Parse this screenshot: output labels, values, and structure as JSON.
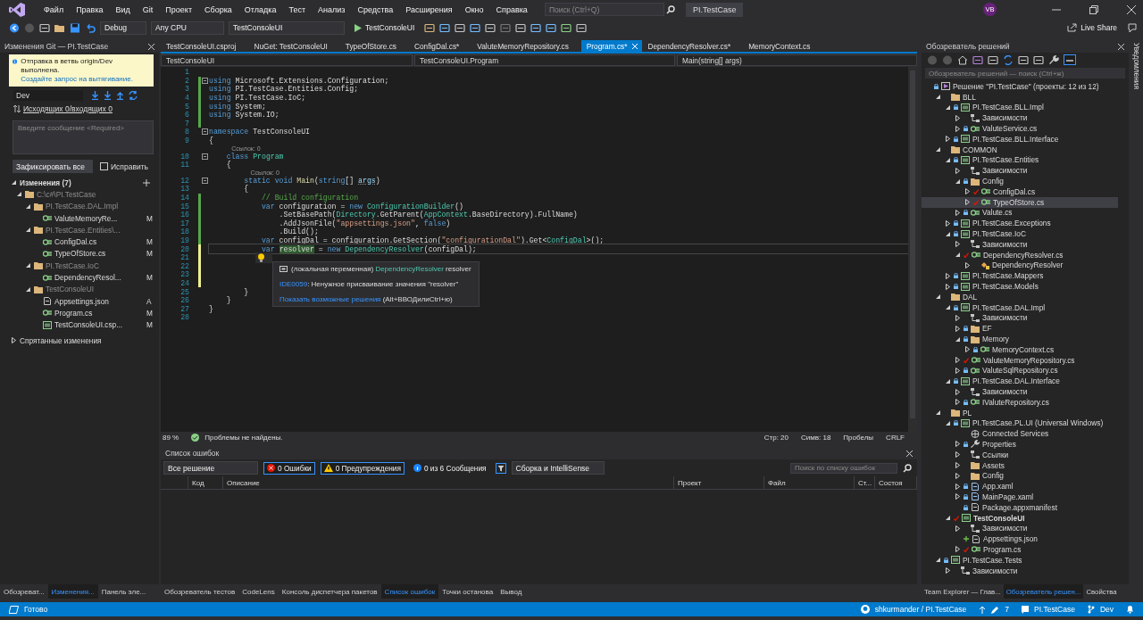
{
  "window": {
    "title": "PI.TestCase",
    "avatar": "VB",
    "live_share": "Live Share"
  },
  "menu": [
    "Файл",
    "Правка",
    "Вид",
    "Git",
    "Проект",
    "Сборка",
    "Отладка",
    "Тест",
    "Анализ",
    "Средства",
    "Расширения",
    "Окно",
    "Справка"
  ],
  "search": {
    "placeholder": "Поиск (Ctrl+Q)"
  },
  "toolbar": {
    "configuration": "Debug",
    "platform": "Any CPU",
    "startup_project": "TestConsoleUI",
    "run": "TestConsoleUI"
  },
  "git_panel": {
    "title": "Изменения Git — PI.TestCase",
    "notice": [
      {
        "kind": "plain",
        "text": "Отправка в ветвь origin/Dev выполнена. "
      },
      {
        "kind": "link",
        "text": "Создайте запрос на вытягивание."
      }
    ],
    "branch": "Dev",
    "sync": "Исходящих 0/входящих 0",
    "message": {
      "placeholder": "Введите сообщение <Required>"
    },
    "commit_button": "Зафиксировать все",
    "amend": {
      "label": "Исправить",
      "checked": false
    },
    "changes": {
      "label": "Изменения (7)",
      "expanded": true,
      "children": [
        {
          "label": "C:\\c#\\PI.TestCase",
          "kind": "folder",
          "expanded": true,
          "children": [
            {
              "label": "PI.TestCase.DAL.Impl",
              "kind": "folder",
              "expanded": true,
              "children": [
                {
                  "label": "ValuteMemoryRe...",
                  "kind": "cs",
                  "change": "M"
                }
              ]
            },
            {
              "label": "PI.TestCase.Entities\\...",
              "kind": "folder",
              "expanded": true,
              "children": [
                {
                  "label": "ConfigDal.cs",
                  "kind": "cs",
                  "change": "M"
                },
                {
                  "label": "TypeOfStore.cs",
                  "kind": "cs",
                  "change": "M"
                }
              ]
            },
            {
              "label": "PI.TestCase.IoC",
              "kind": "folder",
              "expanded": true,
              "children": [
                {
                  "label": "DependencyResol...",
                  "kind": "cs",
                  "change": "M"
                }
              ]
            },
            {
              "label": "TestConsoleUI",
              "kind": "folder",
              "expanded": true,
              "children": [
                {
                  "label": "Appsettings.json",
                  "kind": "json",
                  "change": "A"
                },
                {
                  "label": "Program.cs",
                  "kind": "cs",
                  "change": "M"
                },
                {
                  "label": "TestConsoleUI.csp...",
                  "kind": "csproj",
                  "change": "M"
                }
              ]
            }
          ]
        }
      ]
    },
    "stashes": {
      "label": "Спрятанные изменения",
      "expanded": false
    }
  },
  "doc_tabs": [
    {
      "label": "TestConsoleUI.csproj",
      "selected": false
    },
    {
      "label": "NuGet: TestConsoleUI",
      "selected": false
    },
    {
      "label": "TypeOfStore.cs",
      "selected": false
    },
    {
      "label": "ConfigDal.cs*",
      "selected": false
    },
    {
      "label": "ValuteMemoryRepository.cs",
      "selected": false
    },
    {
      "label": "Program.cs*",
      "selected": true
    },
    {
      "label": "DependencyResolver.cs*",
      "selected": false
    },
    {
      "label": "MemoryContext.cs",
      "selected": false
    }
  ],
  "nav_bar": {
    "project": "TestConsoleUI",
    "type": "TestConsoleUI.Program",
    "member": "Main(string[] args)"
  },
  "code": [
    {
      "num": "1"
    },
    {
      "num": "2",
      "saved": true,
      "fold": true,
      "tokens": [
        {
          "kind": "kw",
          "text": "using"
        },
        {
          "kind": "plain",
          "text": " Microsoft.Extensions.Configuration;"
        }
      ]
    },
    {
      "num": "3",
      "saved": true,
      "tokens": [
        {
          "kind": "kw",
          "text": "using"
        },
        {
          "kind": "plain",
          "text": " PI.TestCase.Entities.Config;"
        }
      ]
    },
    {
      "num": "4",
      "saved": true,
      "tokens": [
        {
          "kind": "kw",
          "text": "using"
        },
        {
          "kind": "plain",
          "text": " PI.TestCase.IoC;"
        }
      ]
    },
    {
      "num": "5",
      "saved": true,
      "tokens": [
        {
          "kind": "kw",
          "text": "using"
        },
        {
          "kind": "plain",
          "text": " System;"
        }
      ]
    },
    {
      "num": "6",
      "saved": true,
      "tokens": [
        {
          "kind": "kw",
          "text": "using"
        },
        {
          "kind": "plain",
          "text": " System.IO;"
        }
      ]
    },
    {
      "num": "7",
      "saved": true
    },
    {
      "num": "8",
      "fold": true,
      "tokens": [
        {
          "kind": "kw",
          "text": "namespace"
        },
        {
          "kind": "plain",
          "text": " TestConsoleUI"
        }
      ]
    },
    {
      "num": "9",
      "tokens": [
        {
          "kind": "plain",
          "text": "{"
        }
      ]
    },
    {
      "num": "10",
      "fold": true,
      "lens": "Ссылок: 0",
      "tokens": [
        {
          "kind": "kw",
          "text": "    class "
        },
        {
          "kind": "type",
          "text": "Program"
        }
      ]
    },
    {
      "num": "11",
      "tokens": [
        {
          "kind": "plain",
          "text": "    {"
        }
      ]
    },
    {
      "num": "12",
      "fold": true,
      "lens": "Ссылок: 0",
      "tokens": [
        {
          "kind": "kw",
          "text": "        static void "
        },
        {
          "kind": "method",
          "text": "Main"
        },
        {
          "kind": "plain",
          "text": "("
        },
        {
          "kind": "kw",
          "text": "string"
        },
        {
          "kind": "plain",
          "text": "[] "
        },
        {
          "kind": "param",
          "text": "args"
        },
        {
          "kind": "plain",
          "text": ")"
        }
      ]
    },
    {
      "num": "13",
      "tokens": [
        {
          "kind": "plain",
          "text": "        {"
        }
      ]
    },
    {
      "num": "14",
      "saved": true,
      "tokens": [
        {
          "kind": "comment",
          "text": "            // Build configuration"
        }
      ]
    },
    {
      "num": "15",
      "saved": true,
      "tokens": [
        {
          "kind": "kw",
          "text": "            var"
        },
        {
          "kind": "plain",
          "text": " configuration = "
        },
        {
          "kind": "kw",
          "text": "new "
        },
        {
          "kind": "type",
          "text": "ConfigurationBuilder"
        },
        {
          "kind": "plain",
          "text": "()"
        }
      ]
    },
    {
      "num": "16",
      "saved": true,
      "tokens": [
        {
          "kind": "plain",
          "text": "                .SetBasePath("
        },
        {
          "kind": "type",
          "text": "Directory"
        },
        {
          "kind": "plain",
          "text": ".GetParent("
        },
        {
          "kind": "type",
          "text": "AppContext"
        },
        {
          "kind": "plain",
          "text": ".BaseDirectory).FullName)"
        }
      ]
    },
    {
      "num": "17",
      "saved": true,
      "tokens": [
        {
          "kind": "plain",
          "text": "                .AddJsonFile("
        },
        {
          "kind": "string",
          "text": "\"appsettings.json\""
        },
        {
          "kind": "plain",
          "text": ", "
        },
        {
          "kind": "kw",
          "text": "false"
        },
        {
          "kind": "plain",
          "text": ")"
        }
      ]
    },
    {
      "num": "18",
      "saved": true,
      "tokens": [
        {
          "kind": "plain",
          "text": "                .Build();"
        }
      ]
    },
    {
      "num": "19",
      "saved": true,
      "tokens": [
        {
          "kind": "kw",
          "text": "            var"
        },
        {
          "kind": "plain",
          "text": " configDal = configuration.GetSection("
        },
        {
          "kind": "string",
          "text": "\"configurationDal\""
        },
        {
          "kind": "plain",
          "text": ").Get<"
        },
        {
          "kind": "type",
          "text": "ConfigDal"
        },
        {
          "kind": "plain",
          "text": ">();"
        }
      ]
    },
    {
      "num": "20",
      "saved": false,
      "current": true,
      "tokens": [
        {
          "kind": "kw",
          "text": "            var "
        },
        {
          "kind": "highlight",
          "text": "resolver"
        },
        {
          "kind": "plain",
          "text": " = "
        },
        {
          "kind": "kw",
          "text": "new "
        },
        {
          "kind": "type",
          "text": "DependencyResolver"
        },
        {
          "kind": "plain",
          "text": "(configDal);"
        }
      ]
    },
    {
      "num": "21",
      "saved": false,
      "lightbulb": true
    },
    {
      "num": "22",
      "saved": false
    },
    {
      "num": "23",
      "saved": false
    },
    {
      "num": "24",
      "saved": false
    },
    {
      "num": "25",
      "tokens": [
        {
          "kind": "plain",
          "text": "        }"
        }
      ]
    },
    {
      "num": "26",
      "tokens": [
        {
          "kind": "plain",
          "text": "    }"
        }
      ]
    },
    {
      "num": "27",
      "tokens": [
        {
          "kind": "plain",
          "text": "}"
        }
      ]
    },
    {
      "num": "28"
    }
  ],
  "quick_info": [
    [
      {
        "kind": "plain",
        "text": "(локальная переменная) "
      },
      {
        "kind": "type",
        "text": "DependencyResolver"
      },
      {
        "kind": "plain",
        "text": " resolver"
      }
    ],
    [
      {
        "kind": "link",
        "text": "IDE0059"
      },
      {
        "kind": "plain",
        "text": ": Ненужное присваивание значения \"resolver\""
      }
    ],
    [
      {
        "kind": "link",
        "text": "Показать возможные решения"
      },
      {
        "kind": "plain",
        "text": " (Alt+ВВОДилиCtrl+ю)"
      }
    ]
  ],
  "editor_status": {
    "zoom": "89 %",
    "issues": "Проблемы не найдены.",
    "line": "Стр: 20",
    "column": "Симв: 18",
    "whitespace": "Пробелы",
    "line_endings": "CRLF"
  },
  "error_list": {
    "title": "Список ошибок",
    "scope": "Все решение",
    "errors": {
      "label": "0 Ошибки",
      "selected": true
    },
    "warnings": {
      "label": "0 Предупреждения",
      "selected": true
    },
    "messages": {
      "label": "0 из 6 Сообщения",
      "selected": false
    },
    "source": "Сборка и IntelliSense",
    "search": {
      "placeholder": "Поиск по списку ошибок"
    },
    "columns": [
      "Код",
      "Описание",
      "Проект",
      "Файл",
      "Ст...",
      "Состоя"
    ]
  },
  "left_tabs": [
    {
      "label": "Обозреват...",
      "selected": false
    },
    {
      "label": "Изменения...",
      "selected": true
    },
    {
      "label": "Панель эле...",
      "selected": false
    }
  ],
  "bottom_tabs": [
    {
      "label": "Обозреватель тестов",
      "selected": false
    },
    {
      "label": "CodeLens",
      "selected": false
    },
    {
      "label": "Консоль диспетчера пакетов",
      "selected": false
    },
    {
      "label": "Список ошибок",
      "selected": true
    },
    {
      "label": "Точки останова",
      "selected": false
    },
    {
      "label": "Вывод",
      "selected": false
    }
  ],
  "solution_explorer": {
    "title": "Обозреватель решений",
    "search": {
      "placeholder": "Обозреватель решений — поиск (Ctrl+ж)"
    },
    "tree": [
      {
        "label": "Решение \"PI.TestCase\" (проекты: 12 из 12)",
        "kind": "solution",
        "locked": true,
        "children": [
          {
            "label": "BLL",
            "kind": "folder",
            "expanded": true,
            "children": [
              {
                "label": "PI.TestCase.BLL.Impl",
                "kind": "project",
                "locked": true,
                "expanded": true,
                "children": [
                  {
                    "label": "Зависимости",
                    "kind": "deps",
                    "expanded": false
                  },
                  {
                    "label": "ValuteService.cs",
                    "kind": "cs",
                    "locked": true,
                    "expanded": false
                  }
                ]
              },
              {
                "label": "PI.TestCase.BLL.Interface",
                "kind": "project",
                "locked": true,
                "expanded": false
              }
            ]
          },
          {
            "label": "COMMON",
            "kind": "folder",
            "expanded": true,
            "children": [
              {
                "label": "PI.TestCase.Entities",
                "kind": "project",
                "locked": true,
                "expanded": true,
                "children": [
                  {
                    "label": "Зависимости",
                    "kind": "deps",
                    "expanded": false
                  },
                  {
                    "label": "Config",
                    "kind": "folder",
                    "locked": true,
                    "expanded": true,
                    "children": [
                      {
                        "label": "ConfigDal.cs",
                        "kind": "cs",
                        "changed": true,
                        "expanded": false,
                        "selected": false
                      },
                      {
                        "label": "TypeOfStore.cs",
                        "kind": "cs",
                        "changed": true,
                        "expanded": false,
                        "selected": true
                      }
                    ]
                  },
                  {
                    "label": "Valute.cs",
                    "kind": "cs",
                    "locked": true,
                    "expanded": false
                  }
                ]
              },
              {
                "label": "PI.TestCase.Exceptions",
                "kind": "project",
                "locked": true,
                "expanded": false
              },
              {
                "label": "PI.TestCase.IoC",
                "kind": "project",
                "locked": true,
                "expanded": true,
                "children": [
                  {
                    "label": "Зависимости",
                    "kind": "deps",
                    "expanded": false
                  },
                  {
                    "label": "DependencyResolver.cs",
                    "kind": "cs",
                    "changed": true,
                    "expanded": true,
                    "children": [
                      {
                        "label": "DependencyResolver",
                        "kind": "class",
                        "expanded": false
                      }
                    ]
                  }
                ]
              },
              {
                "label": "PI.TestCase.Mappers",
                "kind": "project",
                "locked": true,
                "expanded": false
              },
              {
                "label": "PI.TestCase.Models",
                "kind": "project",
                "locked": true,
                "expanded": false
              }
            ]
          },
          {
            "label": "DAL",
            "kind": "folder",
            "expanded": true,
            "children": [
              {
                "label": "PI.TestCase.DAL.Impl",
                "kind": "project",
                "locked": true,
                "expanded": true,
                "children": [
                  {
                    "label": "Зависимости",
                    "kind": "deps",
                    "expanded": false
                  },
                  {
                    "label": "EF",
                    "kind": "folder",
                    "locked": true,
                    "expanded": false
                  },
                  {
                    "label": "Memory",
                    "kind": "folder",
                    "locked": true,
                    "expanded": true,
                    "children": [
                      {
                        "label": "MemoryContext.cs",
                        "kind": "cs",
                        "locked": true,
                        "expanded": false
                      }
                    ]
                  },
                  {
                    "label": "ValuteMemoryRepository.cs",
                    "kind": "cs",
                    "changed": true,
                    "expanded": false
                  },
                  {
                    "label": "ValuteSqlRepository.cs",
                    "kind": "cs",
                    "locked": true,
                    "expanded": false
                  }
                ]
              },
              {
                "label": "PI.TestCase.DAL.Interface",
                "kind": "project",
                "locked": true,
                "expanded": true,
                "children": [
                  {
                    "label": "Зависимости",
                    "kind": "deps",
                    "expanded": false
                  },
                  {
                    "label": "IValuteRepository.cs",
                    "kind": "cs",
                    "locked": true,
                    "expanded": false
                  }
                ]
              }
            ]
          },
          {
            "label": "PL",
            "kind": "folder",
            "expanded": true,
            "children": [
              {
                "label": "PI.TestCase.PL.UI (Universal Windows)",
                "kind": "project",
                "locked": true,
                "expanded": true,
                "children": [
                  {
                    "label": "Connected Services",
                    "kind": "service"
                  },
                  {
                    "label": "Properties",
                    "kind": "wrench",
                    "locked": true,
                    "expanded": false
                  },
                  {
                    "label": "Ссылки",
                    "kind": "deps",
                    "expanded": false
                  },
                  {
                    "label": "Assets",
                    "kind": "folder",
                    "expanded": false
                  },
                  {
                    "label": "Config",
                    "kind": "folder",
                    "expanded": false
                  },
                  {
                    "label": "App.xaml",
                    "kind": "xaml",
                    "locked": true,
                    "expanded": false
                  },
                  {
                    "label": "MainPage.xaml",
                    "kind": "xaml",
                    "locked": true,
                    "expanded": false
                  },
                  {
                    "label": "Package.appxmanifest",
                    "kind": "manifest",
                    "locked": true
                  }
                ]
              },
              {
                "label": "TestConsoleUI",
                "kind": "project",
                "changed": true,
                "startup": true,
                "expanded": true,
                "children": [
                  {
                    "label": "Зависимости",
                    "kind": "deps",
                    "expanded": false
                  },
                  {
                    "label": "Appsettings.json",
                    "kind": "json",
                    "added": true
                  },
                  {
                    "label": "Program.cs",
                    "kind": "cs",
                    "changed": true,
                    "expanded": false
                  }
                ]
              }
            ]
          },
          {
            "label": "PI.TestCase.Tests",
            "kind": "testproject",
            "locked": true,
            "expanded": true,
            "children": [
              {
                "label": "Зависимости",
                "kind": "deps",
                "expanded": false
              }
            ]
          }
        ]
      }
    ]
  },
  "right_tabs": [
    {
      "label": "Team Explorer — Глав...",
      "selected": false
    },
    {
      "label": "Обозреватель решен...",
      "selected": true
    },
    {
      "label": "Свойства",
      "selected": false
    }
  ],
  "notifications_strip": "Уведомления",
  "status_bar": {
    "state": "Готово",
    "repository": "shkurmander / PI.TestCase",
    "changes": "7",
    "solution": "PI.TestCase",
    "branch": "Dev"
  }
}
